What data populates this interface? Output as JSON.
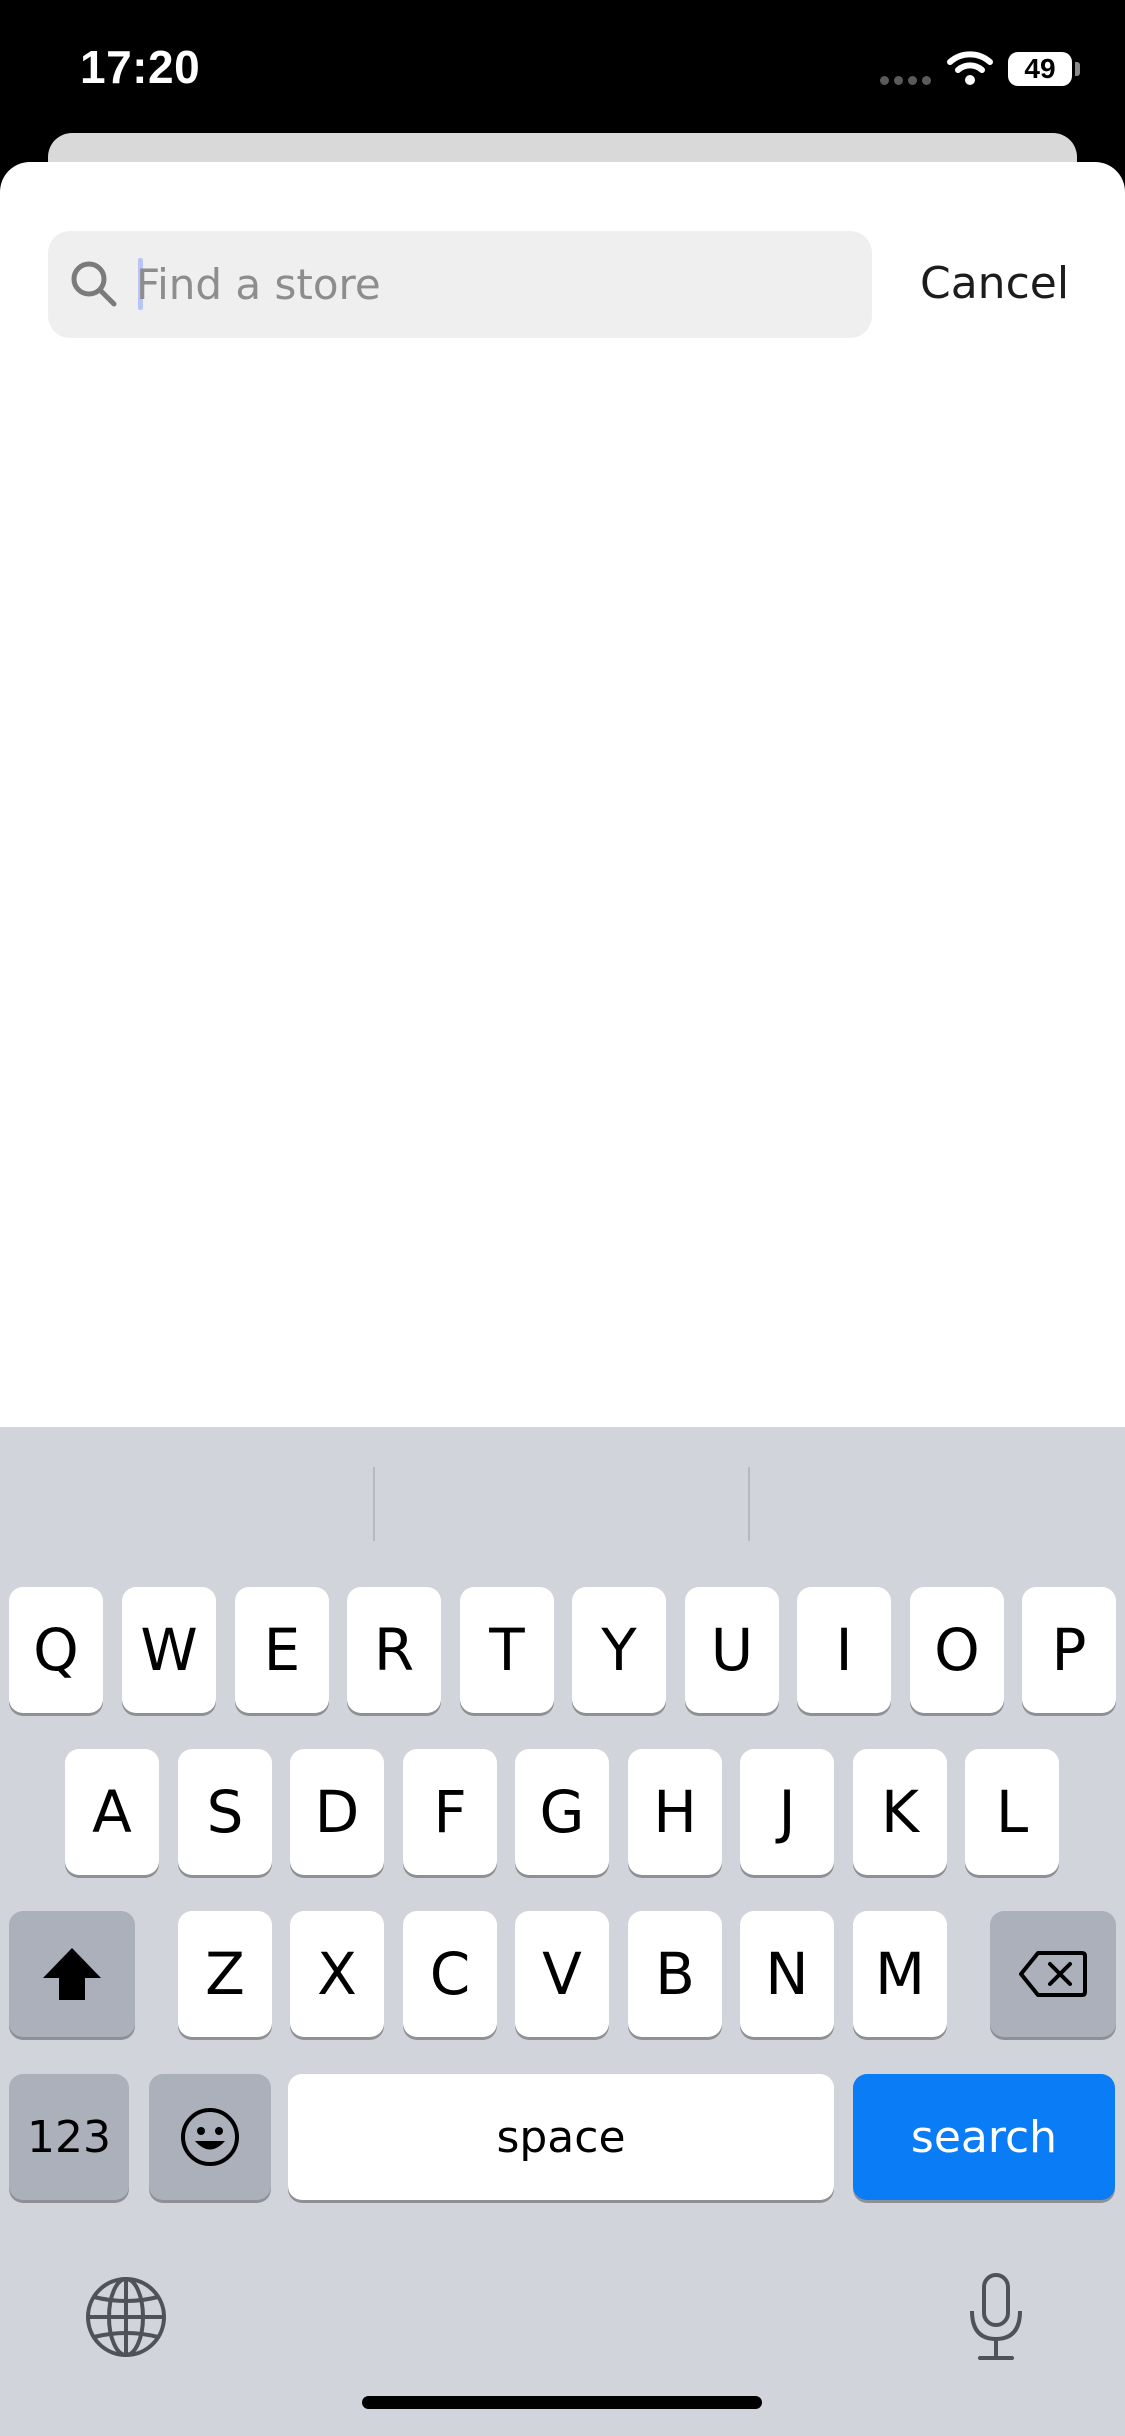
{
  "status_bar": {
    "time": "17:20",
    "battery_level": "49"
  },
  "search": {
    "placeholder": "Find a store",
    "value": ""
  },
  "cancel_label": "Cancel",
  "keyboard": {
    "row1": [
      "Q",
      "W",
      "E",
      "R",
      "T",
      "Y",
      "U",
      "I",
      "O",
      "P"
    ],
    "row2": [
      "A",
      "S",
      "D",
      "F",
      "G",
      "H",
      "J",
      "K",
      "L"
    ],
    "row3": [
      "Z",
      "X",
      "C",
      "V",
      "B",
      "N",
      "M"
    ],
    "numbers_label": "123",
    "space_label": "space",
    "search_label": "search"
  },
  "colors": {
    "accent": "#0a7cf6",
    "keyboard_bg": "#d1d4da"
  }
}
